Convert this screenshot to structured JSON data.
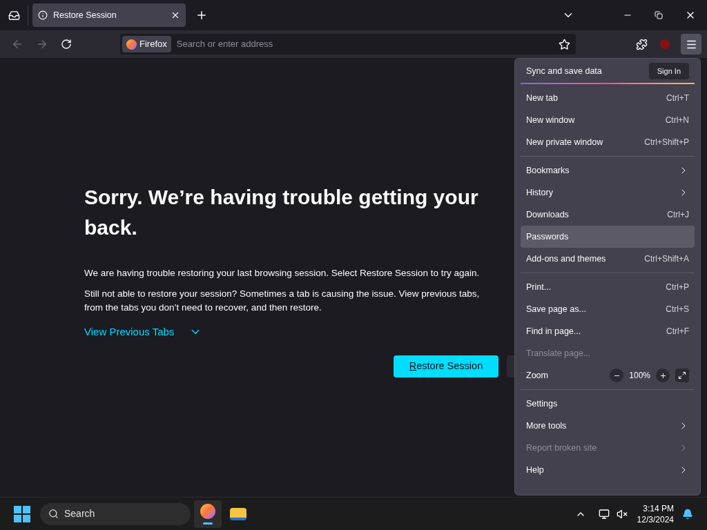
{
  "tabs": [
    {
      "title": "Restore Session",
      "selected": true
    }
  ],
  "address_bar": {
    "identity": "Firefox",
    "placeholder": "Search or enter address"
  },
  "page": {
    "heading_lines": [
      "Sorry. We’re having trouble getting your",
      "back."
    ],
    "paragraphs": [
      [
        "We are having trouble restoring your last browsing session. Select Restore Session to try again."
      ],
      [
        "Still not able to restore your session? Sometimes a tab is causing the issue. View previous tabs,",
        "from the tabs you don’t need to recover, and then restore."
      ]
    ],
    "toggle": {
      "label": "View Previous Tabs",
      "expanded": false
    },
    "primary_button": "Restore Session"
  },
  "menu": {
    "header": {
      "label": "Sync and save data",
      "button": "Sign In"
    },
    "sections": [
      {
        "items": [
          {
            "kind": "item",
            "label": "New tab",
            "shortcut": "Ctrl+T",
            "selected": false,
            "disabled": false
          },
          {
            "kind": "item",
            "label": "New window",
            "shortcut": "Ctrl+N",
            "selected": false,
            "disabled": false
          },
          {
            "kind": "item",
            "label": "New private window",
            "shortcut": "Ctrl+Shift+P",
            "selected": false,
            "disabled": false
          }
        ]
      },
      {
        "items": [
          {
            "kind": "submenu",
            "label": "Bookmarks",
            "selected": false,
            "disabled": false
          },
          {
            "kind": "submenu",
            "label": "History",
            "selected": false,
            "disabled": false
          },
          {
            "kind": "item",
            "label": "Downloads",
            "shortcut": "Ctrl+J",
            "selected": false,
            "disabled": false
          },
          {
            "kind": "item",
            "label": "Passwords",
            "selected": true,
            "disabled": false
          },
          {
            "kind": "item",
            "label": "Add-ons and themes",
            "shortcut": "Ctrl+Shift+A",
            "selected": false,
            "disabled": false
          }
        ]
      },
      {
        "items": [
          {
            "kind": "item",
            "label": "Print...",
            "shortcut": "Ctrl+P",
            "selected": false,
            "disabled": false
          },
          {
            "kind": "item",
            "label": "Save page as...",
            "shortcut": "Ctrl+S",
            "selected": false,
            "disabled": false
          },
          {
            "kind": "item",
            "label": "Find in page...",
            "shortcut": "Ctrl+F",
            "selected": false,
            "disabled": false
          },
          {
            "kind": "item",
            "label": "Translate page...",
            "selected": false,
            "disabled": true
          },
          {
            "kind": "zoom",
            "label": "Zoom",
            "value": "100%",
            "selected": false,
            "disabled": false
          }
        ]
      },
      {
        "items": [
          {
            "kind": "item",
            "label": "Settings",
            "selected": false,
            "disabled": false
          },
          {
            "kind": "submenu",
            "label": "More tools",
            "selected": false,
            "disabled": false
          },
          {
            "kind": "submenu",
            "label": "Report broken site",
            "selected": false,
            "disabled": true
          },
          {
            "kind": "submenu",
            "label": "Help",
            "selected": false,
            "disabled": false
          }
        ]
      }
    ]
  },
  "taskbar": {
    "search_placeholder": "Search",
    "time": "3:14 PM",
    "date": "12/3/2024"
  }
}
